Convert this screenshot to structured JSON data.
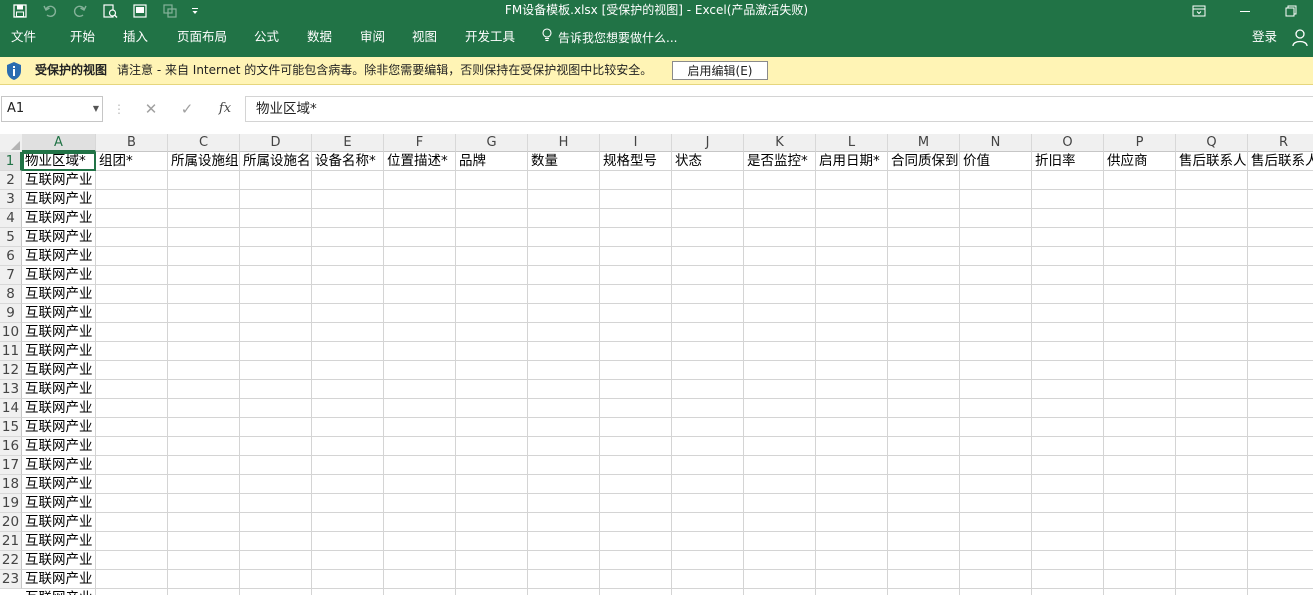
{
  "window": {
    "title": "FM设备模板.xlsx  [受保护的视图] - Excel(产品激活失败)",
    "qat": [
      "save-icon",
      "undo-icon",
      "redo-icon",
      "print-preview-icon",
      "form-icon",
      "touch-mode-icon",
      "customize-qat-icon"
    ]
  },
  "ribbon": {
    "tabs": [
      "文件",
      "开始",
      "插入",
      "页面布局",
      "公式",
      "数据",
      "审阅",
      "视图",
      "开发工具"
    ],
    "tell_me": "告诉我您想要做什么...",
    "login": "登录"
  },
  "message_bar": {
    "title": "受保护的视图",
    "text": "请注意 - 来自 Internet 的文件可能包含病毒。除非您需要编辑，否则保持在受保护视图中比较安全。",
    "button": "启用编辑(E)"
  },
  "formula_bar": {
    "name_box": "A1",
    "fx": "fx",
    "formula": "物业区域*"
  },
  "sheet": {
    "columns": [
      "A",
      "B",
      "C",
      "D",
      "E",
      "F",
      "G",
      "H",
      "I",
      "J",
      "K",
      "L",
      "M",
      "N",
      "O",
      "P",
      "Q",
      "R"
    ],
    "selected_cell": "A1",
    "header_row": [
      "物业区域*",
      "组团*",
      "所属设施组",
      "所属设施名",
      "设备名称*",
      "位置描述*",
      "品牌",
      "数量",
      "规格型号",
      "状态",
      "是否监控*",
      "启用日期*",
      "合同质保到",
      "价值",
      "折旧率",
      "供应商",
      "售后联系人",
      "售后联系人"
    ],
    "row_numbers": [
      "1",
      "2",
      "3",
      "4",
      "5",
      "6",
      "7",
      "8",
      "9",
      "10",
      "11",
      "12",
      "13",
      "14",
      "15",
      "16",
      "17",
      "18",
      "19",
      "20",
      "21",
      "22",
      "23"
    ],
    "column_a_values": [
      "互联网产业",
      "互联网产业",
      "互联网产业",
      "互联网产业",
      "互联网产业",
      "互联网产业",
      "互联网产业",
      "互联网产业",
      "互联网产业",
      "互联网产业",
      "互联网产业",
      "互联网产业",
      "互联网产业",
      "互联网产业",
      "互联网产业",
      "互联网产业",
      "互联网产业",
      "互联网产业",
      "互联网产业",
      "互联网产业",
      "互联网产业",
      "互联网产业",
      "互联网产业"
    ]
  },
  "colors": {
    "accent": "#217346",
    "message_bar_bg": "#fff4b5"
  }
}
